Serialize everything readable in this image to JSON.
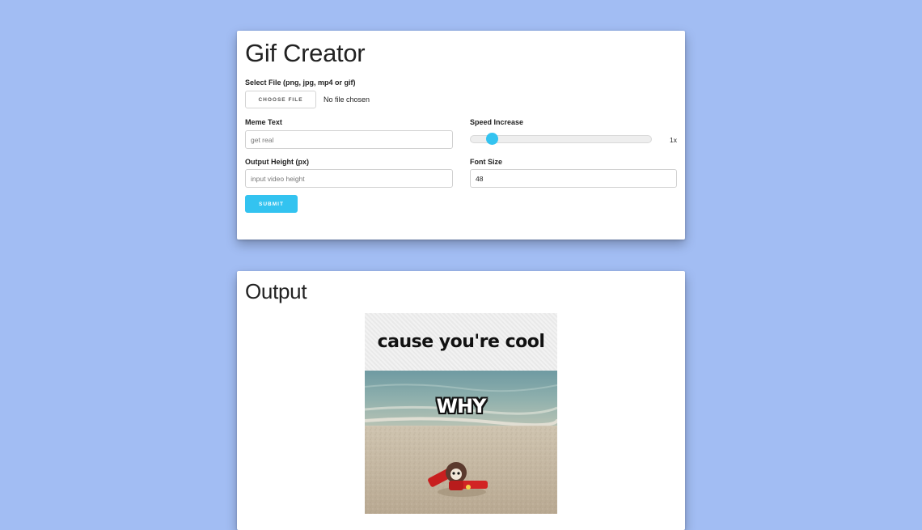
{
  "creator": {
    "title": "Gif Creator",
    "file_label": "Select File (png, jpg, mp4 or gif)",
    "file_button": "CHOOSE FILE",
    "file_status": "No file chosen",
    "meme_text_label": "Meme Text",
    "meme_text_placeholder": "get real",
    "meme_text_value": "",
    "speed_label": "Speed Increase",
    "speed_value_text": "1x",
    "speed_slider_fraction": 0.12,
    "height_label": "Output Height (px)",
    "height_placeholder": "input video height",
    "height_value": "",
    "font_size_label": "Font Size",
    "font_size_value": "48",
    "submit_label": "SUBMIT"
  },
  "output": {
    "title": "Output",
    "gif_caption": "cause you're cool",
    "gif_overlay_text": "WHY"
  },
  "colors": {
    "background": "#a2bdf3",
    "accent": "#33c3f0"
  }
}
